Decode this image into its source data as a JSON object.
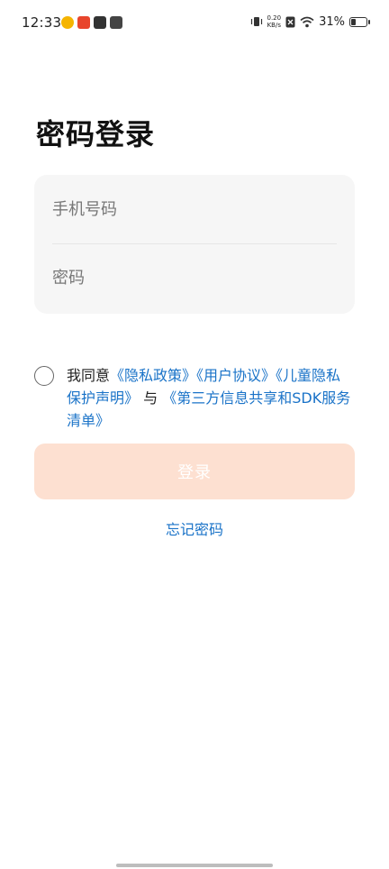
{
  "status_bar": {
    "time": "12:33",
    "net_speed_value": "0.20",
    "net_speed_unit": "KB/s",
    "battery_text": "31%",
    "battery_level": 0.31,
    "app_icons": [
      "weibo-icon",
      "news-icon",
      "link-app-icon",
      "mail-app-icon"
    ]
  },
  "login": {
    "title": "密码登录",
    "phone_placeholder": "手机号码",
    "password_placeholder": "密码",
    "button_label": "登录",
    "forgot_label": "忘记密码"
  },
  "agreement": {
    "prefix": "我同意",
    "privacy_policy": "《隐私政策》",
    "user_agreement": "《用户协议》",
    "child_privacy": "《儿童隐私保护声明》",
    "conj": "与",
    "third_party": "《第三方信息共享和SDK服务清单》"
  },
  "colors": {
    "link": "#1a73c8",
    "button_disabled": "#fde0d1",
    "input_bg": "#f6f6f6"
  }
}
